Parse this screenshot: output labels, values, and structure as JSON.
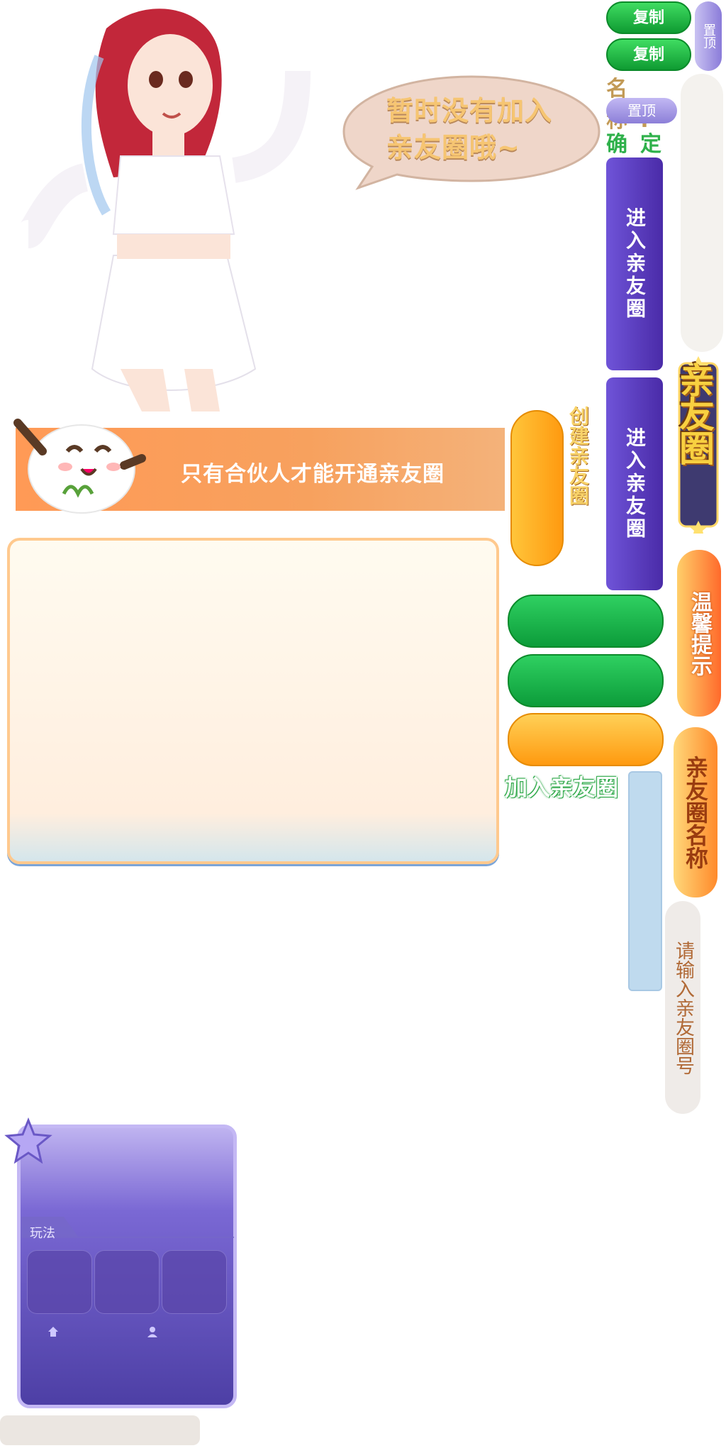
{
  "bubble": {
    "text_line1": "暂时没有加入",
    "text_line2": "亲友圈哦~"
  },
  "right_panel": {
    "copy_button_1": "复制",
    "copy_button_2": "复制",
    "pin_vertical": "置顶",
    "name_label": "名称:",
    "pin_button": "置顶",
    "confirm_label": "确定",
    "enter_button_1": "进入亲友圈",
    "enter_button_2": "进入亲友圈",
    "logo_text": "亲友圈",
    "tip_button": "温馨提示",
    "circle_name": "亲友圈名称",
    "input_hint": "请输入亲友圈号"
  },
  "create": {
    "label": "创建亲友圈"
  },
  "join": {
    "label": "加入亲友圈"
  },
  "banner": {
    "text": "只有合伙人才能开通亲友圈"
  },
  "card": {
    "tab_label": "玩法"
  },
  "colors": {
    "purple": "#5a3fc0",
    "green": "#18b043",
    "orange": "#ff9a10",
    "banner": "#f7a15e"
  }
}
